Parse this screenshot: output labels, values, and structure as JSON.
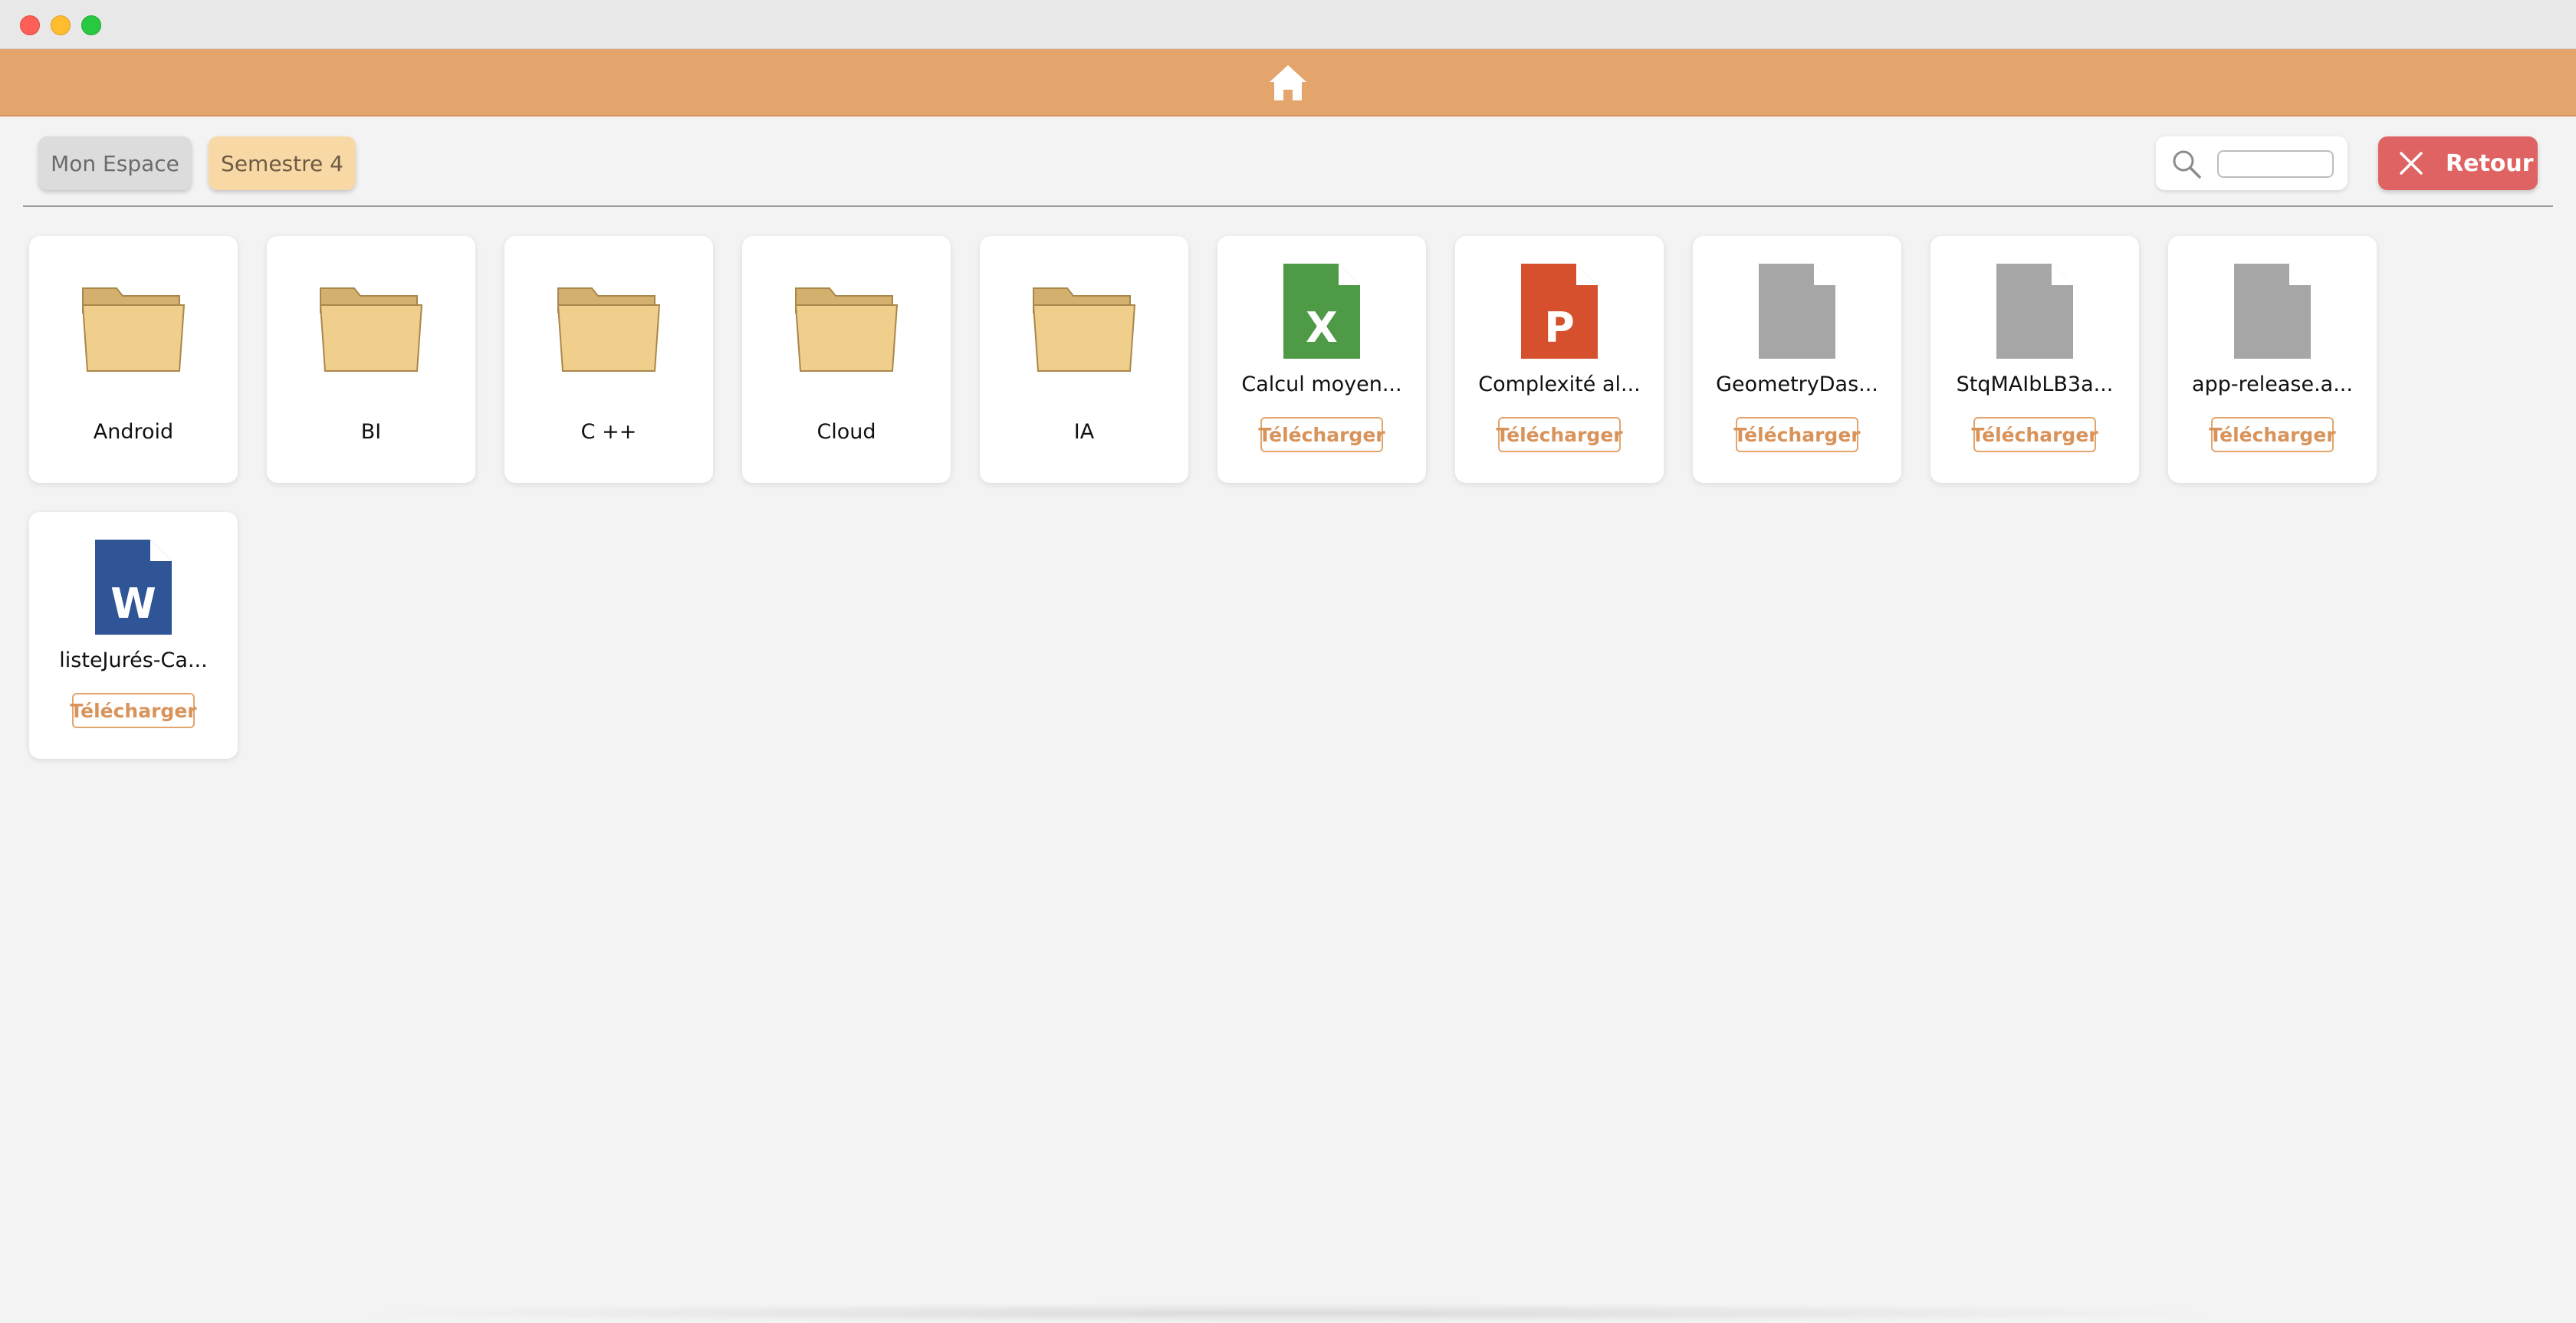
{
  "header": {
    "home_icon": "home-icon",
    "accent_color": "#e3a56c"
  },
  "breadcrumb": [
    {
      "label": "Mon Espace"
    },
    {
      "label": "Semestre 4"
    }
  ],
  "search": {
    "value": "",
    "placeholder": ""
  },
  "back_button": {
    "label": "Retour",
    "icon": "close-icon",
    "color": "#e06363"
  },
  "folders": [
    {
      "name": "Android"
    },
    {
      "name": "BI"
    },
    {
      "name": "C ++"
    },
    {
      "name": "Cloud"
    },
    {
      "name": "IA"
    }
  ],
  "files": [
    {
      "name": "Calcul moyen...",
      "type": "excel",
      "letter": "X",
      "color": "#4e9a47"
    },
    {
      "name": "Complexité al...",
      "type": "powerpoint",
      "letter": "P",
      "color": "#d6502d"
    },
    {
      "name": "GeometryDas...",
      "type": "generic",
      "letter": "",
      "color": "#a6a6a6"
    },
    {
      "name": "StqMAIbLB3a...",
      "type": "generic",
      "letter": "",
      "color": "#a6a6a6"
    },
    {
      "name": "app-release.a...",
      "type": "generic",
      "letter": "",
      "color": "#a6a6a6"
    },
    {
      "name": "listeJurés-Ca...",
      "type": "word",
      "letter": "W",
      "color": "#2f5597"
    }
  ],
  "download_label": "Télécharger"
}
